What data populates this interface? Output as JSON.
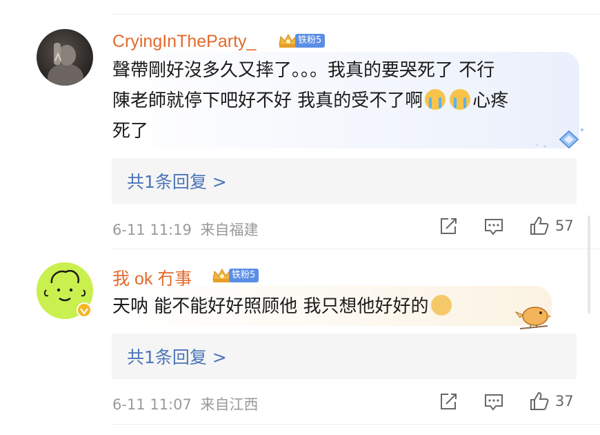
{
  "comments": [
    {
      "username": "CryingInTheParty_",
      "fan_badge": "铁粉5",
      "text_line1": "聲帶剛好沒多久又摔了。。。我真的要哭死了 不行",
      "text_line2a": "陳老師就停下吧好不好 我真的受不了啊",
      "text_line2b": "心疼",
      "text_line3": "死了",
      "reply_label": "共1条回复 >",
      "timestamp": "6-11 11:19",
      "location": "来自福建",
      "likes": "57",
      "icons": [
        "share-icon",
        "comment-icon",
        "like-icon"
      ]
    },
    {
      "username": "我 ok 冇事_",
      "fan_badge": "铁粉5",
      "text": "天呐 能不能好好照顾他 我只想他好好的",
      "reply_label": "共1条回复 >",
      "timestamp": "6-11 11:07",
      "location": "来自江西",
      "likes": "37",
      "icons": [
        "share-icon",
        "comment-icon",
        "like-icon"
      ]
    }
  ],
  "colors": {
    "username": "#e26a2c",
    "reply_link": "#4a74b8",
    "fan_badge": "#5a8ee6",
    "meta": "#9a9a9a"
  }
}
